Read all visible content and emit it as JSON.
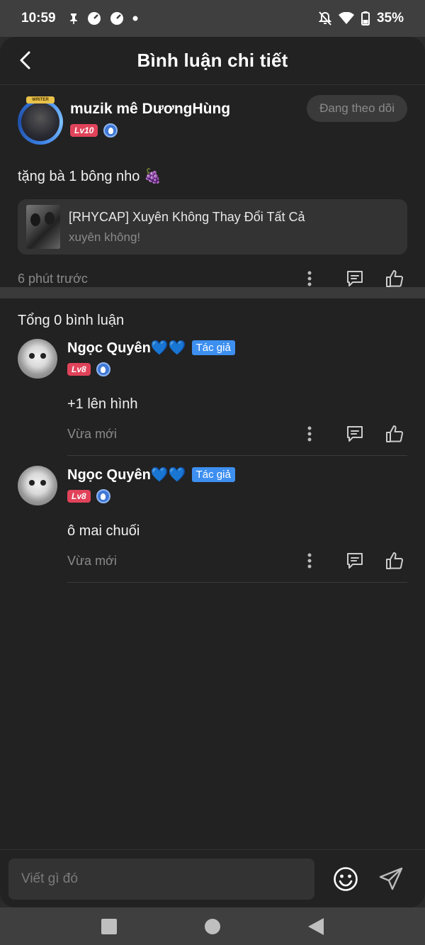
{
  "status_bar": {
    "time": "10:59",
    "battery": "35%",
    "icons_left": [
      "pin-icon",
      "speedometer-icon",
      "speedometer-icon",
      "dot-icon"
    ],
    "icons_right": [
      "bell-off-icon",
      "wifi-icon",
      "battery-icon"
    ]
  },
  "header": {
    "title": "Bình luận chi tiết",
    "back_icon": "chevron-left-icon"
  },
  "post": {
    "author_name": "muzik mê DươngHùng",
    "level": "Lv10",
    "follow_label": "Đang theo dõi",
    "text": "tặng bà 1 bông nho 🍇",
    "linked_card": {
      "title": "[RHYCAP] Xuyên Không Thay Đổi Tất Cả",
      "subtitle": "xuyên không!"
    },
    "time": "6 phút trước"
  },
  "comments": {
    "total_label": "Tổng 0 bình luận",
    "items": [
      {
        "name": "Ngọc Quyên💙💙",
        "tag": "Tác giả",
        "level": "Lv8",
        "text": "+1 lên hình",
        "time": "Vừa mới"
      },
      {
        "name": "Ngọc Quyên💙💙",
        "tag": "Tác giả",
        "level": "Lv8",
        "text": "ô mai chuối",
        "time": "Vừa mới"
      }
    ]
  },
  "input": {
    "placeholder": "Viết gì đó"
  },
  "colors": {
    "background": "#222222",
    "accent": "#3d8ff0",
    "level_badge": "#e0435a"
  }
}
